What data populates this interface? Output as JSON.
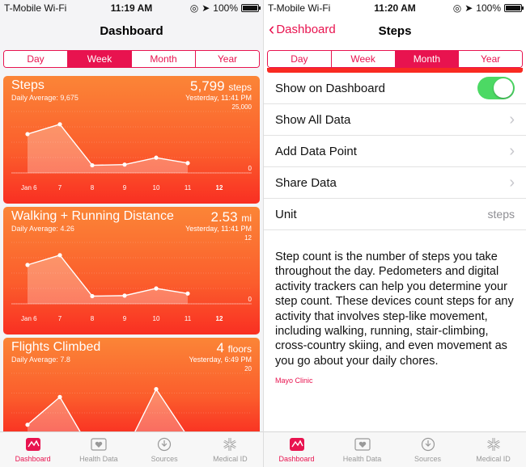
{
  "left": {
    "status": {
      "carrier": "T-Mobile Wi-Fi",
      "time": "11:19 AM",
      "battery": "100%",
      "battery_level": 1.0
    },
    "title": "Dashboard",
    "segments": [
      "Day",
      "Week",
      "Month",
      "Year"
    ],
    "active_segment": "Week",
    "cards": [
      {
        "title": "Steps",
        "value": "5,799",
        "unit": "steps",
        "daily_average": "Daily Average: 9,675",
        "time": "Yesterday, 11:41 PM",
        "y_max_label": "25,000",
        "y_min_label": "0",
        "x_labels": [
          "Jan 6",
          "7",
          "8",
          "9",
          "10",
          "11",
          "12"
        ],
        "chart_data": {
          "type": "area",
          "categories": [
            "Jan 6",
            "7",
            "8",
            "9",
            "10",
            "11",
            "12"
          ],
          "values": [
            15800,
            19800,
            3100,
            3400,
            6200,
            4000,
            null
          ],
          "ylim": [
            0,
            25000
          ]
        }
      },
      {
        "title": "Walking + Running Distance",
        "value": "2.53",
        "unit": "mi",
        "daily_average": "Daily Average: 4.26",
        "time": "Yesterday, 11:41 PM",
        "y_max_label": "12",
        "y_min_label": "0",
        "x_labels": [
          "Jan 6",
          "7",
          "8",
          "9",
          "10",
          "11",
          "12"
        ],
        "chart_data": {
          "type": "area",
          "categories": [
            "Jan 6",
            "7",
            "8",
            "9",
            "10",
            "11",
            "12"
          ],
          "values": [
            7.6,
            9.5,
            1.5,
            1.6,
            3.0,
            2.0,
            null
          ],
          "ylim": [
            0,
            12
          ]
        }
      },
      {
        "title": "Flights Climbed",
        "value": "4",
        "unit": "floors",
        "daily_average": "Daily Average: 7.8",
        "time": "Yesterday, 6:49 PM",
        "y_max_label": "20",
        "y_min_label": "",
        "x_labels": [],
        "chart_data": {
          "type": "area",
          "categories": [
            "Jan 6",
            "7",
            "8",
            "9",
            "10",
            "11",
            "12"
          ],
          "values": [
            7,
            14,
            0,
            0,
            16,
            4,
            null
          ],
          "ylim": [
            0,
            20
          ]
        }
      }
    ],
    "tabs": [
      {
        "label": "Dashboard",
        "icon": "dashboard-icon",
        "active": true
      },
      {
        "label": "Health Data",
        "icon": "health-data-icon",
        "active": false
      },
      {
        "label": "Sources",
        "icon": "sources-icon",
        "active": false
      },
      {
        "label": "Medical ID",
        "icon": "medical-id-icon",
        "active": false
      }
    ]
  },
  "right": {
    "status": {
      "carrier": "T-Mobile Wi-Fi",
      "time": "11:20 AM",
      "battery": "100%",
      "battery_level": 1.0
    },
    "back_label": "Dashboard",
    "title": "Steps",
    "segments": [
      "Day",
      "Week",
      "Month",
      "Year"
    ],
    "active_segment": "Month",
    "rows": [
      {
        "label": "Show on Dashboard",
        "kind": "toggle",
        "on": true
      },
      {
        "label": "Show All Data",
        "kind": "chevron"
      },
      {
        "label": "Add Data Point",
        "kind": "chevron"
      },
      {
        "label": "Share Data",
        "kind": "chevron"
      },
      {
        "label": "Unit",
        "kind": "value",
        "value": "steps"
      }
    ],
    "description": "Step count is the number of steps you take throughout the day. Pedometers and digital activity trackers can help you determine your step count. These devices count steps for any activity that involves step-like movement, including walking, running, stair-climbing, cross-country skiing, and even movement as you go about your daily chores.",
    "source": "Mayo Clinic",
    "tabs": [
      {
        "label": "Dashboard",
        "icon": "dashboard-icon",
        "active": true
      },
      {
        "label": "Health Data",
        "icon": "health-data-icon",
        "active": false
      },
      {
        "label": "Sources",
        "icon": "sources-icon",
        "active": false
      },
      {
        "label": "Medical ID",
        "icon": "medical-id-icon",
        "active": false
      }
    ]
  },
  "colors": {
    "accent": "#e8134f",
    "card_top": "#fb8537",
    "card_bottom": "#f92f22",
    "toggle_on": "#4cd964"
  }
}
